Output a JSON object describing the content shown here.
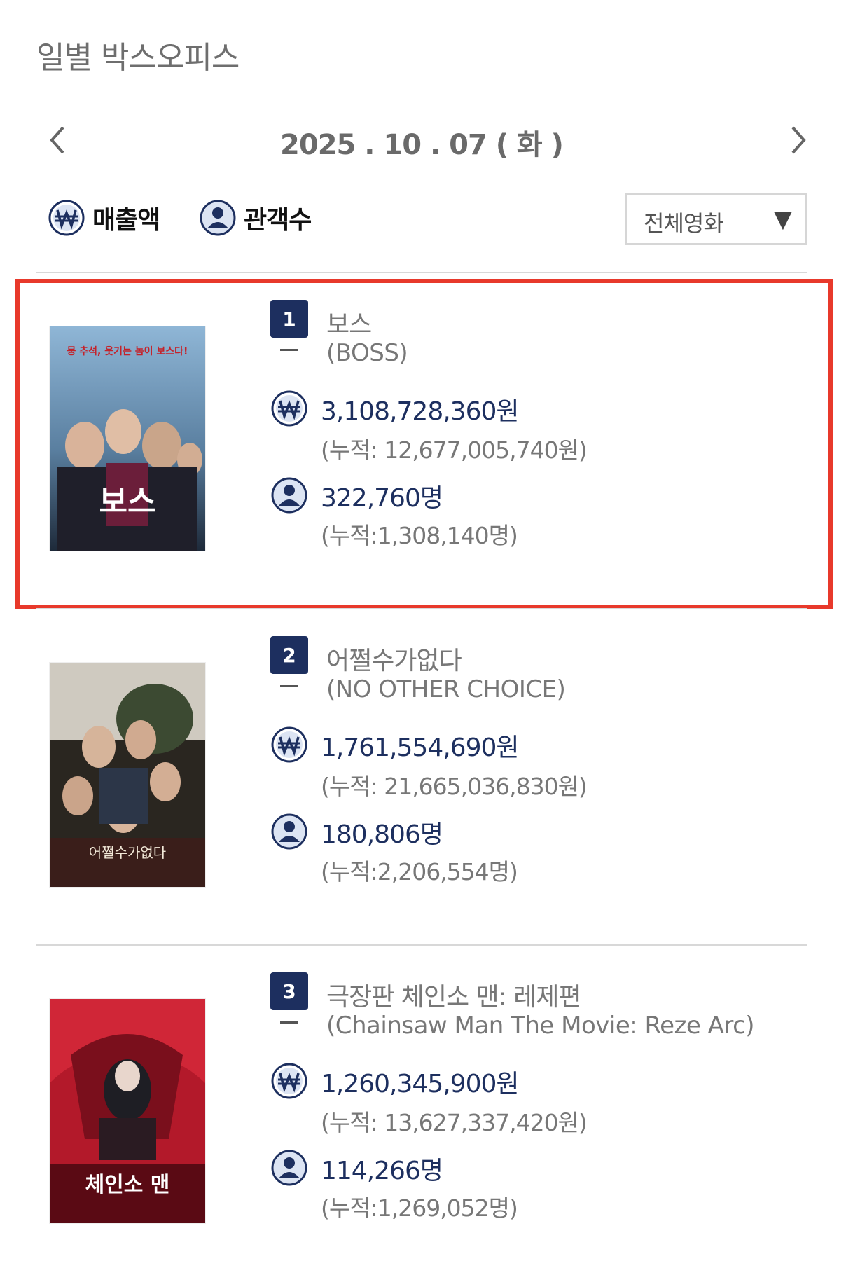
{
  "header": {
    "title": "일별 박스오피스"
  },
  "date_nav": {
    "date": "2025 . 10 . 07 ( 화 )"
  },
  "sort": {
    "sales_label": "매출액",
    "audience_label": "관객수"
  },
  "filter": {
    "selected": "전체영화",
    "arrow": "▼"
  },
  "colors": {
    "accent": "#1d2f5f",
    "highlight": "#e8392b",
    "divider": "#d8d8d8"
  },
  "movies": [
    {
      "rank": "1",
      "title_ko": "보스",
      "title_en": "(BOSS)",
      "sales": "3,108,728,360원",
      "sales_total": "(누적: 12,677,005,740원)",
      "audience": "322,760명",
      "audience_total": "(누적:1,308,140명)",
      "poster_text": "보스",
      "poster_tagline": "뭉 추석, 웃기는 놈이 보스다!"
    },
    {
      "rank": "2",
      "title_ko": "어쩔수가없다",
      "title_en": "(NO OTHER CHOICE)",
      "sales": "1,761,554,690원",
      "sales_total": "(누적: 21,665,036,830원)",
      "audience": "180,806명",
      "audience_total": "(누적:2,206,554명)",
      "poster_text": "어쩔수가없다"
    },
    {
      "rank": "3",
      "title_ko": "극장판 체인소 맨: 레제편",
      "title_en": "(Chainsaw Man The Movie: Reze Arc)",
      "sales": "1,260,345,900원",
      "sales_total": "(누적: 13,627,337,420원)",
      "audience": "114,266명",
      "audience_total": "(누적:1,269,052명)",
      "poster_text": "체인소 맨"
    }
  ],
  "icons": {
    "won": "won-circle-icon",
    "user": "user-circle-icon",
    "prev": "chevron-left-icon",
    "next": "chevron-right-icon"
  }
}
